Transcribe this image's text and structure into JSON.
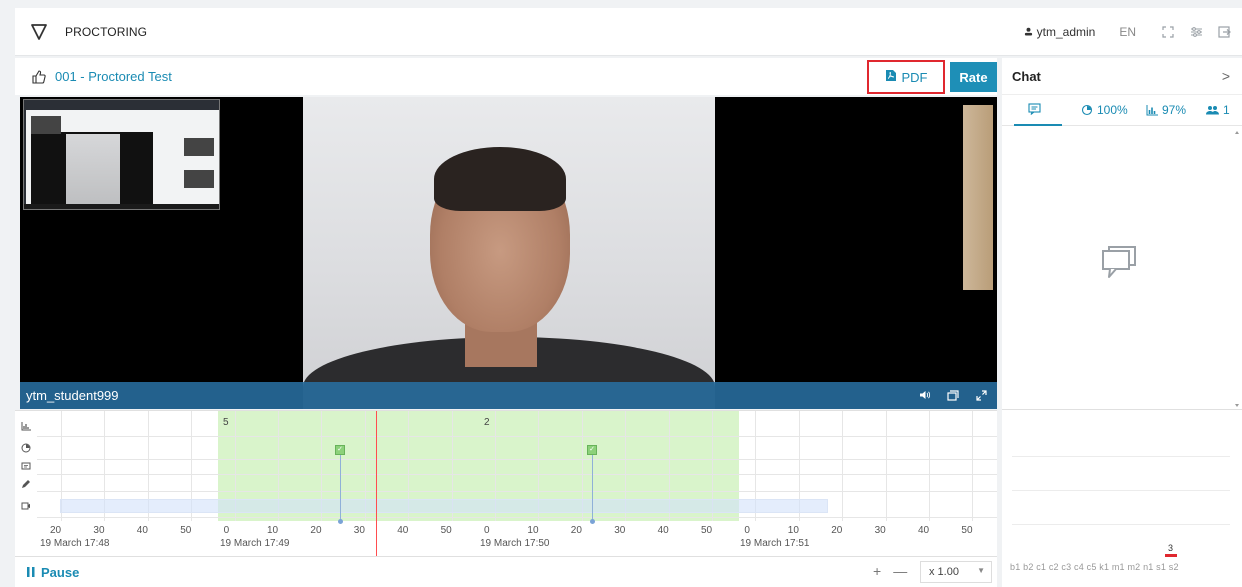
{
  "app": {
    "name": "PROCTORING"
  },
  "header": {
    "user": "ytm_admin",
    "lang": "EN"
  },
  "session": {
    "title": "001 - Proctored Test",
    "pdf_label": "PDF",
    "rate_label": "Rate"
  },
  "video": {
    "student": "ytm_student999"
  },
  "timeline": {
    "band_counts": [
      "5",
      "2"
    ],
    "ticks": [
      {
        "label": "20"
      },
      {
        "label": "30"
      },
      {
        "label": "40"
      },
      {
        "label": "50"
      },
      {
        "label": "0"
      },
      {
        "label": "10"
      },
      {
        "label": "20"
      },
      {
        "label": "30"
      },
      {
        "label": "40"
      },
      {
        "label": "50"
      },
      {
        "label": "0"
      },
      {
        "label": "10"
      },
      {
        "label": "20"
      },
      {
        "label": "30"
      },
      {
        "label": "40"
      },
      {
        "label": "50"
      },
      {
        "label": "0"
      },
      {
        "label": "10"
      },
      {
        "label": "20"
      },
      {
        "label": "30"
      },
      {
        "label": "40"
      },
      {
        "label": "50"
      }
    ],
    "dates": [
      "19 March 17:48",
      "19 March 17:49",
      "19 March 17:50",
      "19 March 17:51"
    ]
  },
  "controls": {
    "pause_label": "Pause",
    "zoom_in": "+",
    "zoom_out": "—",
    "speed": "x 1.00"
  },
  "chat": {
    "title": "Chat",
    "stats": {
      "browser": "100%",
      "score": "97%",
      "users": "1"
    },
    "codes": "b1 b2 c1 c2 c3 c4 c5 k1 m1 m2 n1 s1 s2",
    "codes_count": "3"
  },
  "colors": {
    "accent": "#1a8bb3",
    "highlight": "#e0282f",
    "green": "#aae68c"
  }
}
